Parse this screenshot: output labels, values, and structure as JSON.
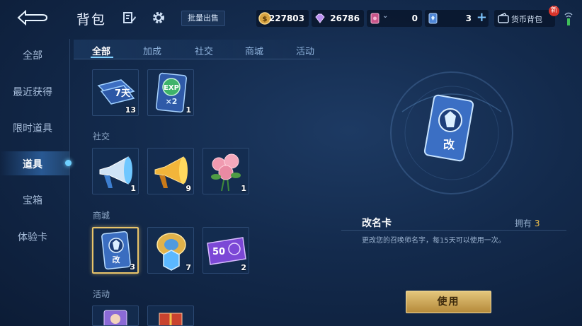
{
  "header": {
    "title": "背包",
    "bulk_sell_label": "批量出售",
    "wallet_label": "货币背包",
    "new_badge": "新"
  },
  "currencies": [
    {
      "name": "gold-coin",
      "value": "227803"
    },
    {
      "name": "diamond",
      "value": "26786"
    },
    {
      "name": "ticket-card",
      "value": "0"
    },
    {
      "name": "blue-card",
      "value": "3"
    }
  ],
  "sidebar": {
    "items": [
      {
        "label": "全部"
      },
      {
        "label": "最近获得"
      },
      {
        "label": "限时道具"
      },
      {
        "label": "道具"
      },
      {
        "label": "宝箱"
      },
      {
        "label": "体验卡"
      }
    ],
    "active_index": 3
  },
  "tabs": [
    {
      "label": "全部"
    },
    {
      "label": "加成"
    },
    {
      "label": "社交"
    },
    {
      "label": "商城"
    },
    {
      "label": "活动"
    }
  ],
  "sections": {
    "social": "社交",
    "mall": "商城",
    "activity": "活动"
  },
  "items": {
    "row1": [
      {
        "icon": "7-day-card-icon",
        "qty": "13",
        "badge_text": "7天"
      },
      {
        "icon": "exp-double-card-icon",
        "qty": "1",
        "badge_text": "EXP",
        "sub_text": "×2"
      }
    ],
    "social": [
      {
        "icon": "blue-loudspeaker-icon",
        "qty": "1"
      },
      {
        "icon": "gold-loudspeaker-icon",
        "qty": "9"
      },
      {
        "icon": "rose-bouquet-icon",
        "qty": "1"
      }
    ],
    "mall": [
      {
        "icon": "rename-card-icon",
        "qty": "3",
        "badge_text": "改"
      },
      {
        "icon": "gold-crest-crystal-icon",
        "qty": "7"
      },
      {
        "icon": "50-coupon-icon",
        "qty": "2",
        "badge_text": "50"
      }
    ]
  },
  "detail": {
    "name": "改名卡",
    "own_label": "拥有",
    "own_count": "3",
    "description": "更改您的召唤师名字，每15天可以使用一次。",
    "use_label": "使用",
    "card_text": "改"
  },
  "colors": {
    "accent": "#7fd0ff",
    "gold": "#e4c67c",
    "background": "#132a4c"
  }
}
